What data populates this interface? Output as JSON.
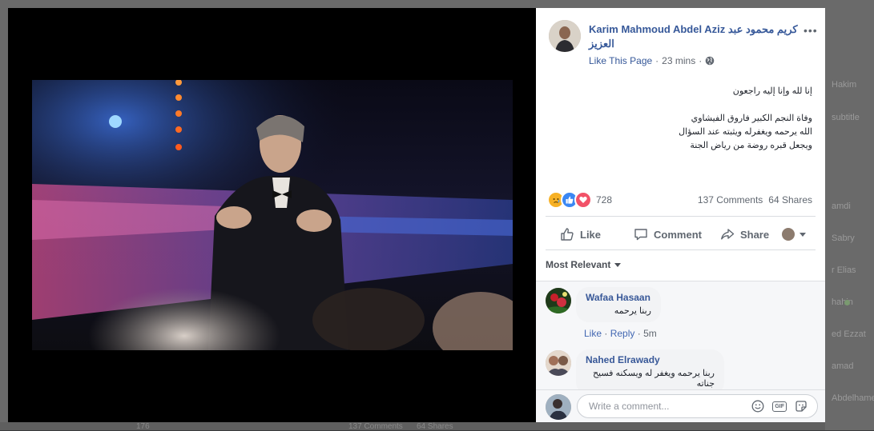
{
  "background": {
    "right_names": [
      "Hakim",
      "subtitle",
      "amdi",
      "Sabry",
      "r Elias",
      "hahin",
      "ed Ezzat",
      "amad",
      "Abdelhame"
    ],
    "bottom_text": [
      "176",
      "137 Comments",
      "64 Shares"
    ]
  },
  "post": {
    "author": "Karim Mahmoud Abdel Aziz كريم محمود عبد العزيز",
    "like_page_label": "Like This Page",
    "separator": "·",
    "time": "23 mins",
    "text_lines": [
      "إنا لله وإنا إليه راجعون",
      "",
      "وفاة النجم الكبير فاروق الفيشاوي",
      "الله يرحمه ويغفرله ويثبته عند السؤال",
      "ويجعل قبره روضة من رياض الجنة"
    ],
    "reaction_count": "728",
    "comments_count": "137 Comments",
    "shares_count": "64 Shares"
  },
  "actions": {
    "like": "Like",
    "comment": "Comment",
    "share": "Share"
  },
  "sort_label": "Most Relevant",
  "comments": [
    {
      "name": "Wafaa Hasaan",
      "text": "ربنا يرحمه",
      "like_label": "Like",
      "reply_label": "Reply",
      "time": "5m"
    },
    {
      "name": "Nahed Elrawady",
      "text": "ربنا يرحمه ويغفر له ويسكنه فسيح جناته"
    }
  ],
  "composer": {
    "placeholder": "Write a comment..."
  },
  "icons": {
    "globe": "globe-icon",
    "like": "thumbs-up-icon",
    "comment": "speech-bubble-icon",
    "share": "share-arrow-icon",
    "emoji": "emoji-icon",
    "gif": "gif-icon",
    "sticker": "sticker-icon"
  },
  "colors": {
    "link_blue": "#365899",
    "like_reaction": "#3b87f3",
    "love_reaction": "#f25268",
    "sad_reaction": "#f7b125"
  }
}
